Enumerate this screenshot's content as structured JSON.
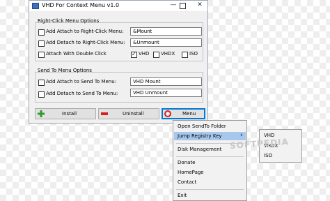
{
  "window": {
    "title": "VHD For Context Menu v1.0",
    "controls": {
      "minimize": "—",
      "close": "✕"
    }
  },
  "right_click": {
    "group_label": "Right-Click Menu Options",
    "attach": {
      "label": "Add Attach to Right-Click Menu:",
      "checked": false,
      "value": "&Mount"
    },
    "detach": {
      "label": "Add Detach to Right-Click Menu:",
      "checked": false,
      "value": "&Unmount"
    },
    "double_click": {
      "label": "Attach With Double Click",
      "checked": false
    },
    "extensions": [
      {
        "label": "VHD",
        "checked": true
      },
      {
        "label": "VHDX",
        "checked": false
      },
      {
        "label": "ISO",
        "checked": false
      }
    ]
  },
  "send_to": {
    "group_label": "Send To Menu Options",
    "attach": {
      "label": "Add Attach to Send To Menu:",
      "checked": false,
      "value": "VHD Mount"
    },
    "detach": {
      "label": "Add Detach to Send To Menu:",
      "checked": false,
      "value": "VHD Unmount"
    }
  },
  "buttons": {
    "install": "Install",
    "uninstall": "Uninstall",
    "menu": "Menu"
  },
  "context_menu": {
    "items": {
      "open_sendto": "Open SendTo Folder",
      "jump_registry": "Jump Registry Key",
      "disk_management": "Disk Management",
      "donate": "Donate",
      "homepage": "HomePage",
      "contact": "Contact",
      "exit": "Exit"
    },
    "submenu_arrow": "›",
    "submenu": [
      "VHD",
      "VHDX",
      "ISO"
    ]
  },
  "watermark": "SOFTPEDIA",
  "colors": {
    "highlight": "#a7c7ec",
    "install_icon": "#2e9b2e",
    "uninstall_icon": "#d62020",
    "menu_icon": "#d62020",
    "focus_border": "#0078d7"
  }
}
